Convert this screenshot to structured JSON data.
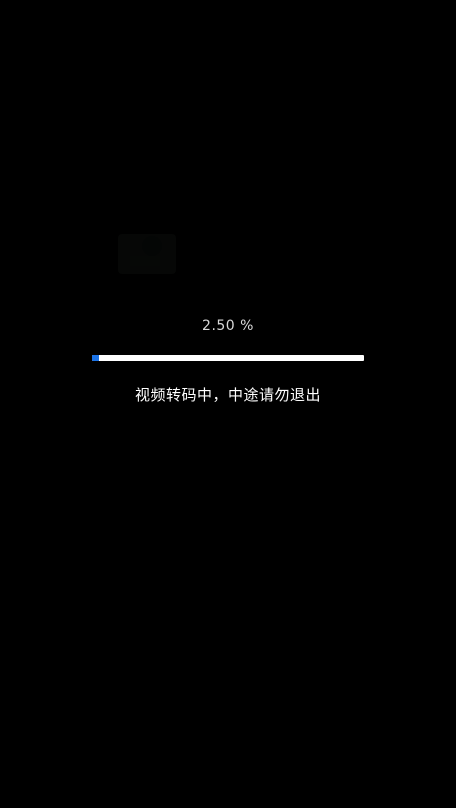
{
  "progress": {
    "percent_text": "2.50 %",
    "value_percent": 2.5,
    "fill_color": "#1a73e8",
    "track_color": "#ffffff"
  },
  "status": {
    "message": "视频转码中，中途请勿退出"
  },
  "colors": {
    "background": "#000000",
    "text": "#ffffff"
  }
}
